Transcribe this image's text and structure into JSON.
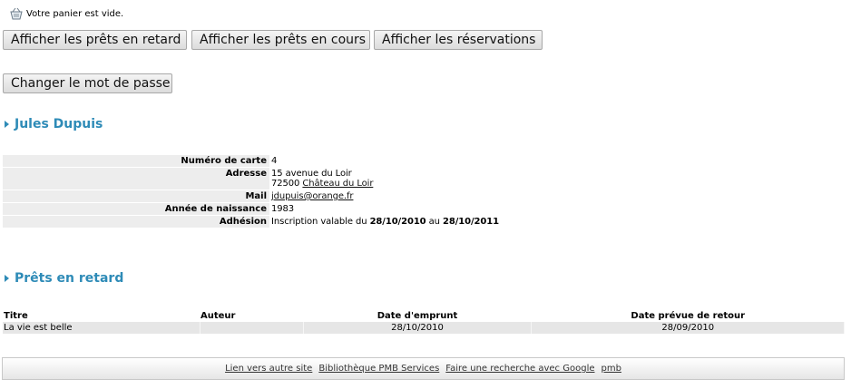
{
  "cart": {
    "icon": "basket-icon",
    "text": "Votre panier est vide."
  },
  "buttons": {
    "late_loans": "Afficher les prêts en retard",
    "current_loans": "Afficher les prêts en cours",
    "reservations": "Afficher les réservations",
    "change_password": "Changer le mot de passe"
  },
  "user": {
    "name": "Jules Dupuis",
    "fields": {
      "card_label": "Numéro de carte",
      "card_value": "4",
      "address_label": "Adresse",
      "address_line1": "15 avenue du Loir",
      "postcode": "72500",
      "city": "Château du Loir",
      "mail_label": "Mail",
      "mail_value": "jdupuis@orange.fr",
      "birth_label": "Année de naissance",
      "birth_value": "1983",
      "membership_label": "Adhésion",
      "membership_prefix": "Inscription valable du",
      "membership_start": "28/10/2010",
      "membership_mid": "au",
      "membership_end": "28/10/2011"
    }
  },
  "late_loans": {
    "title": "Prêts en retard",
    "columns": [
      "Titre",
      "Auteur",
      "Date d'emprunt",
      "Date prévue de retour"
    ],
    "rows": [
      {
        "title": "La vie est belle",
        "author": "",
        "borrow_date": "28/10/2010",
        "return_date": "28/09/2010"
      }
    ]
  },
  "footer": {
    "links": [
      "Lien vers autre site",
      "Bibliothèque PMB Services",
      "Faire une recherche avec Google",
      "pmb"
    ]
  },
  "colors": {
    "section_title": "#2e8bb7",
    "row_bg": "#ededed"
  }
}
